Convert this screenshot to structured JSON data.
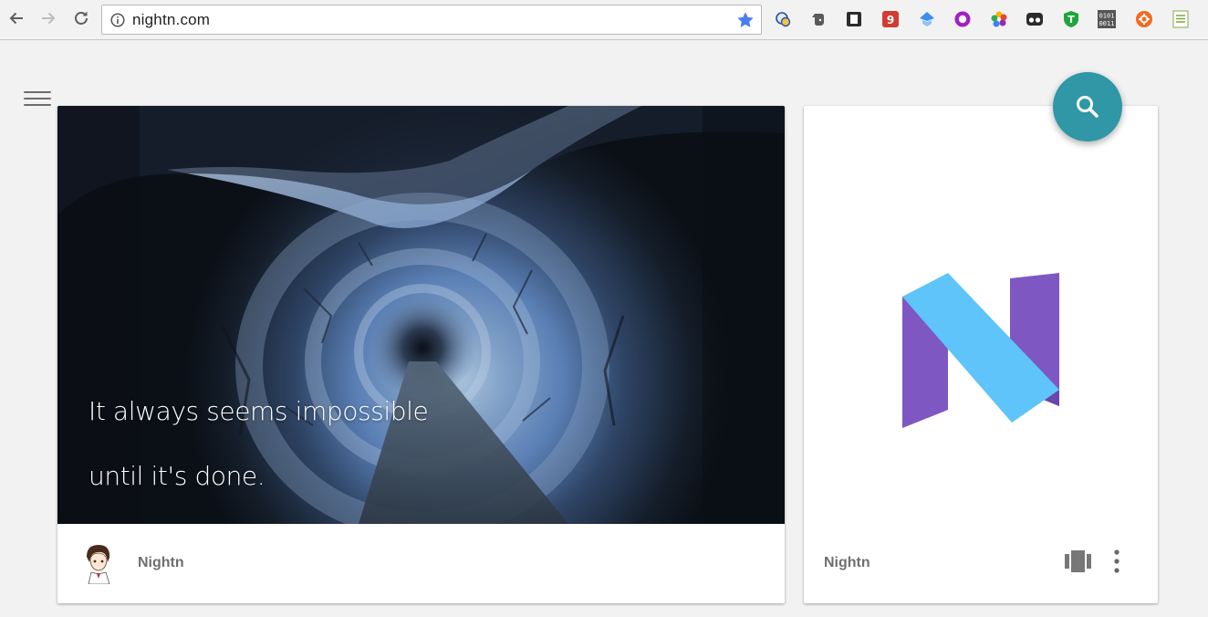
{
  "browser": {
    "url": "nightn.com",
    "extensions": [
      "extension-1-icon",
      "evernote-icon",
      "extension-3-icon",
      "extension-4-icon",
      "extension-5-icon",
      "extension-6-icon",
      "extension-7-icon",
      "extension-8-icon",
      "extension-9-icon",
      "binary-0101-icon",
      "extension-11-icon",
      "extension-12-icon"
    ]
  },
  "featured_card": {
    "quote_line_1": "It always seems impossible",
    "quote_line_2": "until it's done.",
    "author": "Nightn"
  },
  "side_card": {
    "author": "Nightn"
  },
  "colors": {
    "fab": "#2f97a6",
    "logo_purple": "#7e57c2",
    "logo_blue": "#5ec4f9"
  }
}
